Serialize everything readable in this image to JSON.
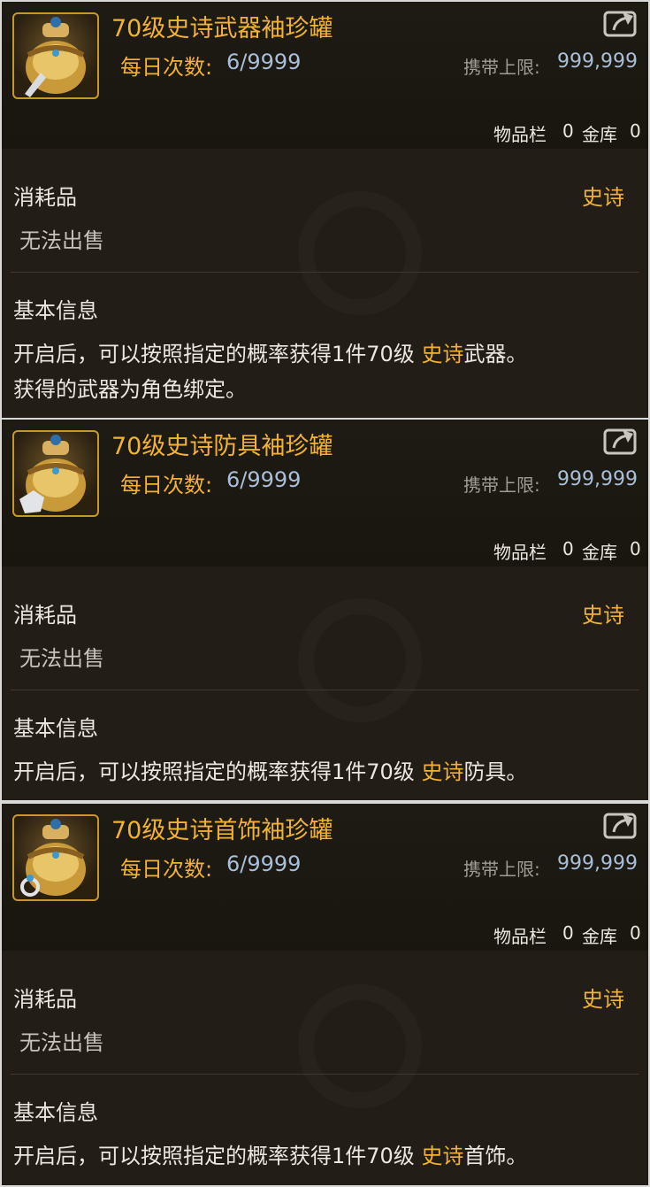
{
  "colors": {
    "accent_gold": "#f2b233",
    "value_blue": "#a9bfd8",
    "panel_bg": "#1a1712",
    "text_light": "#ece8e0",
    "text_muted": "#a09c95"
  },
  "items": [
    {
      "title": "70级史诗武器袖珍罐",
      "daily_label": "每日次数:",
      "daily_value": "6/9999",
      "carry_label": "携带上限:",
      "carry_value": "999,999",
      "inventory_label": "物品栏",
      "inventory_count": "0",
      "vault_label": "金库",
      "vault_count": "0",
      "category": "消耗品",
      "rarity": "史诗",
      "sell_status": "无法出售",
      "basic_info_heading": "基本信息",
      "desc_prefix": "开启后，可以按照指定的概率获得1件70级 ",
      "desc_highlight": "史诗",
      "desc_suffix": "武器。",
      "desc_line2": "获得的武器为角色绑定。",
      "icon_badge": "sword-icon"
    },
    {
      "title": "70级史诗防具袖珍罐",
      "daily_label": "每日次数:",
      "daily_value": "6/9999",
      "carry_label": "携带上限:",
      "carry_value": "999,999",
      "inventory_label": "物品栏",
      "inventory_count": "0",
      "vault_label": "金库",
      "vault_count": "0",
      "category": "消耗品",
      "rarity": "史诗",
      "sell_status": "无法出售",
      "basic_info_heading": "基本信息",
      "desc_prefix": "开启后，可以按照指定的概率获得1件70级 ",
      "desc_highlight": "史诗",
      "desc_suffix": "防具。",
      "desc_line2": "",
      "icon_badge": "armor-icon"
    },
    {
      "title": "70级史诗首饰袖珍罐",
      "daily_label": "每日次数:",
      "daily_value": "6/9999",
      "carry_label": "携带上限:",
      "carry_value": "999,999",
      "inventory_label": "物品栏",
      "inventory_count": "0",
      "vault_label": "金库",
      "vault_count": "0",
      "category": "消耗品",
      "rarity": "史诗",
      "sell_status": "无法出售",
      "basic_info_heading": "基本信息",
      "desc_prefix": "开启后，可以按照指定的概率获得1件70级 ",
      "desc_highlight": "史诗",
      "desc_suffix": "首饰。",
      "desc_line2": "",
      "icon_badge": "ring-icon"
    }
  ]
}
